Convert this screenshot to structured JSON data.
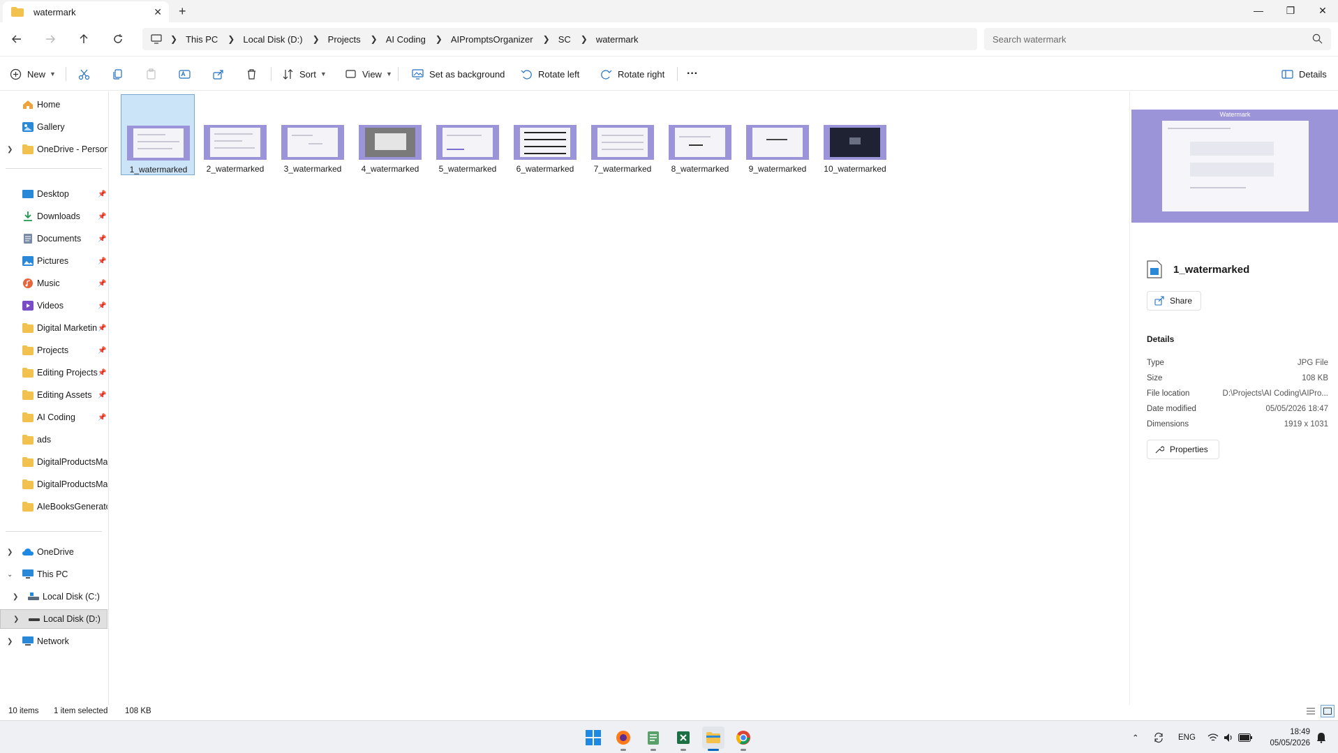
{
  "tab": {
    "title": "watermark"
  },
  "window": {
    "minimize": "—",
    "maximize": "❐",
    "close": "✕"
  },
  "breadcrumb": [
    "This PC",
    "Local Disk (D:)",
    "Projects",
    "AI Coding",
    "AIPromptsOrganizer",
    "SC",
    "watermark"
  ],
  "search": {
    "placeholder": "Search watermark"
  },
  "toolbar": {
    "new_label": "New",
    "sort_label": "Sort",
    "view_label": "View",
    "set_background_label": "Set as background",
    "rotate_left_label": "Rotate left",
    "rotate_right_label": "Rotate right",
    "more_label": "···",
    "details_label": "Details"
  },
  "sidebar": {
    "items": [
      {
        "label": "Home",
        "icon": "home-icon"
      },
      {
        "label": "Gallery",
        "icon": "gallery-icon"
      },
      {
        "label": "OneDrive - Persona",
        "icon": "folder-icon"
      },
      {
        "label": "Desktop",
        "icon": "desktop-icon"
      },
      {
        "label": "Downloads",
        "icon": "download-icon"
      },
      {
        "label": "Documents",
        "icon": "document-icon"
      },
      {
        "label": "Pictures",
        "icon": "pictures-icon"
      },
      {
        "label": "Music",
        "icon": "music-icon"
      },
      {
        "label": "Videos",
        "icon": "videos-icon"
      },
      {
        "label": "Digital Marketin",
        "icon": "folder-icon"
      },
      {
        "label": "Projects",
        "icon": "folder-icon"
      },
      {
        "label": "Editing Projects",
        "icon": "folder-icon"
      },
      {
        "label": "Editing Assets",
        "icon": "folder-icon"
      },
      {
        "label": "AI Coding",
        "icon": "folder-icon"
      },
      {
        "label": "ads",
        "icon": "folder-icon"
      },
      {
        "label": "DigitalProductsMak",
        "icon": "folder-icon"
      },
      {
        "label": "DigitalProductsMak",
        "icon": "folder-icon"
      },
      {
        "label": "AIeBooksGenerator",
        "icon": "folder-icon"
      },
      {
        "label": "OneDrive",
        "icon": "cloud-icon"
      },
      {
        "label": "This PC",
        "icon": "pc-icon"
      },
      {
        "label": "Local Disk (C:)",
        "icon": "drive-icon"
      },
      {
        "label": "Local Disk (D:)",
        "icon": "drive-icon"
      },
      {
        "label": "Network",
        "icon": "network-icon"
      }
    ]
  },
  "files": [
    "1_watermarked",
    "2_watermarked",
    "3_watermarked",
    "4_watermarked",
    "5_watermarked",
    "6_watermarked",
    "7_watermarked",
    "8_watermarked",
    "9_watermarked",
    "10_watermarked"
  ],
  "details_pane": {
    "preview_caption": "Watermark",
    "file_name": "1_watermarked",
    "share_label": "Share",
    "heading": "Details",
    "rows": [
      {
        "key": "Type",
        "value": "JPG File"
      },
      {
        "key": "Size",
        "value": "108 KB"
      },
      {
        "key": "File location",
        "value": "D:\\Projects\\AI Coding\\AIPro..."
      },
      {
        "key": "Date modified",
        "value": "05/05/2026 18:47"
      },
      {
        "key": "Dimensions",
        "value": "1919 x 1031"
      }
    ],
    "properties_label": "Properties"
  },
  "status": {
    "item_count": "10 items",
    "selection": "1 item selected",
    "selection_size": "108 KB"
  },
  "taskbar": {
    "language": "ENG",
    "time": "18:49",
    "date": "05/05/2026"
  },
  "colors": {
    "accent": "#0067c0",
    "thumb_bg": "#9b94d9",
    "selection": "#cce4f7",
    "folder": "#f2c14e"
  }
}
